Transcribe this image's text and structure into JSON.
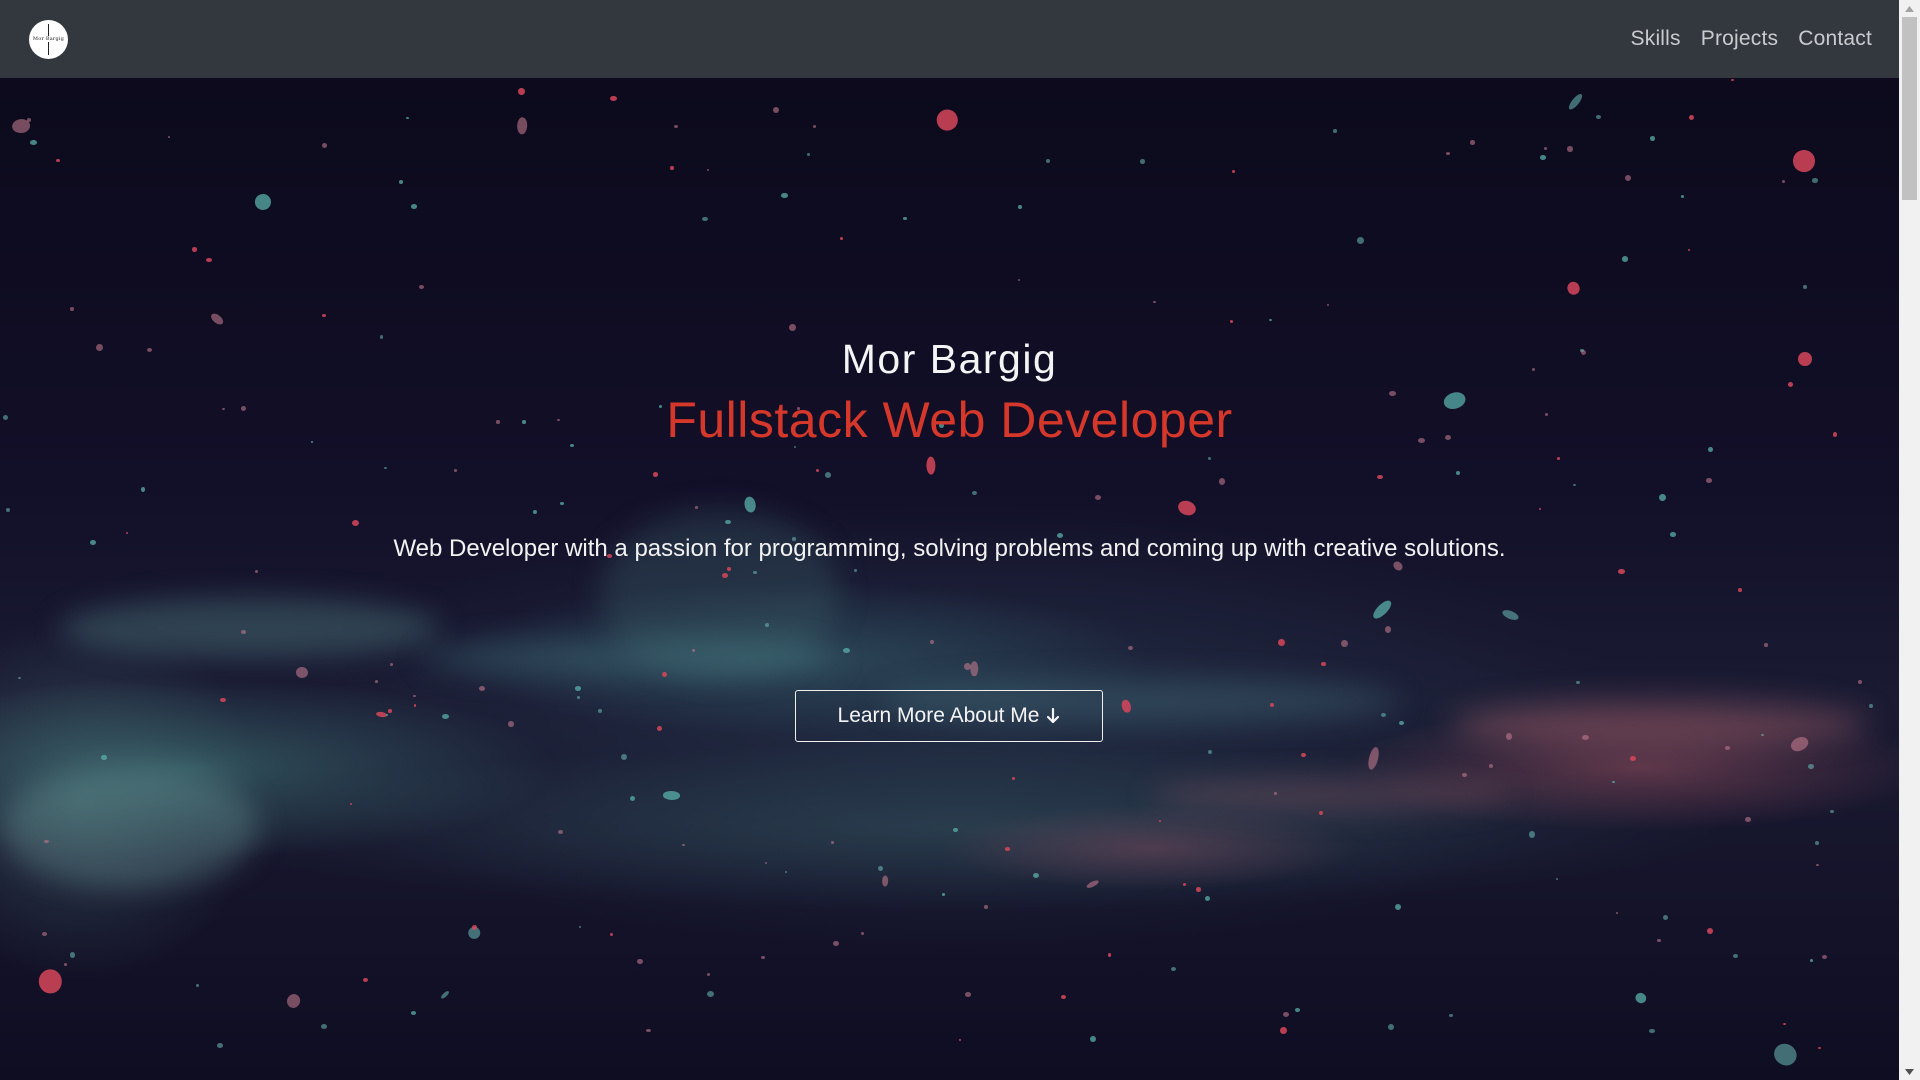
{
  "navbar": {
    "logo_text": "Mor Bargig",
    "links": [
      {
        "label": "Skills"
      },
      {
        "label": "Projects"
      },
      {
        "label": "Contact"
      }
    ],
    "background_color": "#33383f",
    "link_color": "#c9cbce"
  },
  "hero": {
    "name": "Mor Bargig",
    "role": "Fullstack Web Developer",
    "tagline": "Web Developer with a passion for programming, solving problems and coming up with creative solutions.",
    "cta_label": "Learn More About Me",
    "cta_icon": "arrow-down-icon",
    "name_color": "#f4f4f4",
    "role_color": "#d5382a"
  },
  "scrollbar": {
    "up_icon": "triangle-up-icon",
    "down_icon": "triangle-down-icon"
  }
}
